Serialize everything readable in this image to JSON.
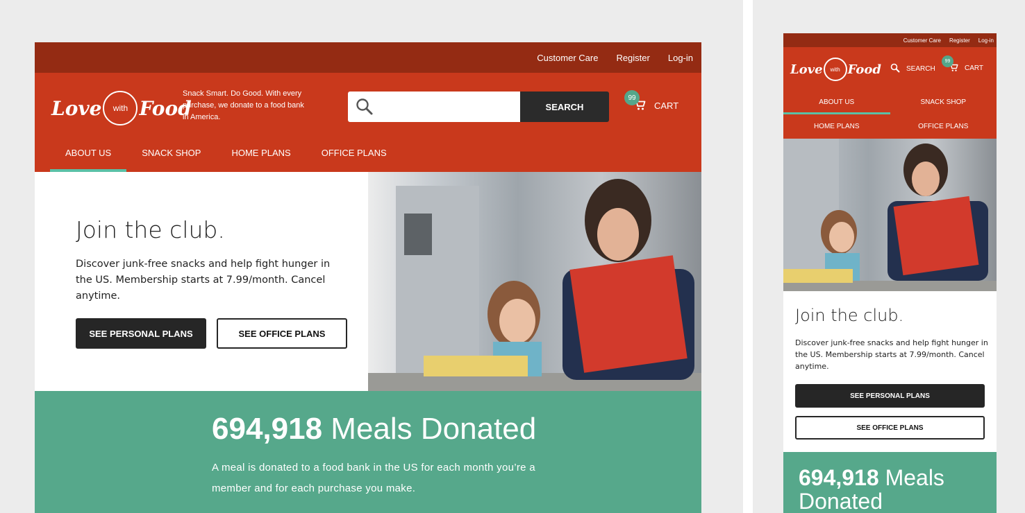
{
  "topbar": {
    "customer_care": "Customer Care",
    "register": "Register",
    "login": "Log-in"
  },
  "brand": {
    "logo_love": "Love",
    "logo_with": "with",
    "logo_food": "Food",
    "tagline": "Snack Smart. Do Good. With every purchase, we donate to a food bank in America."
  },
  "search": {
    "button_label": "SEARCH",
    "placeholder": ""
  },
  "cart": {
    "count": "99",
    "label": "CART"
  },
  "nav": {
    "about_us": "ABOUT US",
    "snack_shop": "SNACK SHOP",
    "home_plans": "HOME PLANS",
    "office_plans": "OFFICE PLANS"
  },
  "hero": {
    "title": "Join the club.",
    "description": "Discover junk-free snacks and help fight hunger in the US. Membership starts at 7.99/month. Cancel anytime.",
    "personal_button": "SEE PERSONAL PLANS",
    "office_button": "SEE OFFICE PLANS"
  },
  "donated": {
    "count": "694,918",
    "label": "Meals Donated",
    "description": "A meal is donated to a food bank in the US for each month you’re a member and for each purchase you make."
  },
  "colors": {
    "topbar": "#942b13",
    "header": "#c9391c",
    "accent": "#5bc0a6",
    "donated_bg": "#56a88b",
    "dark_button": "#262626"
  }
}
